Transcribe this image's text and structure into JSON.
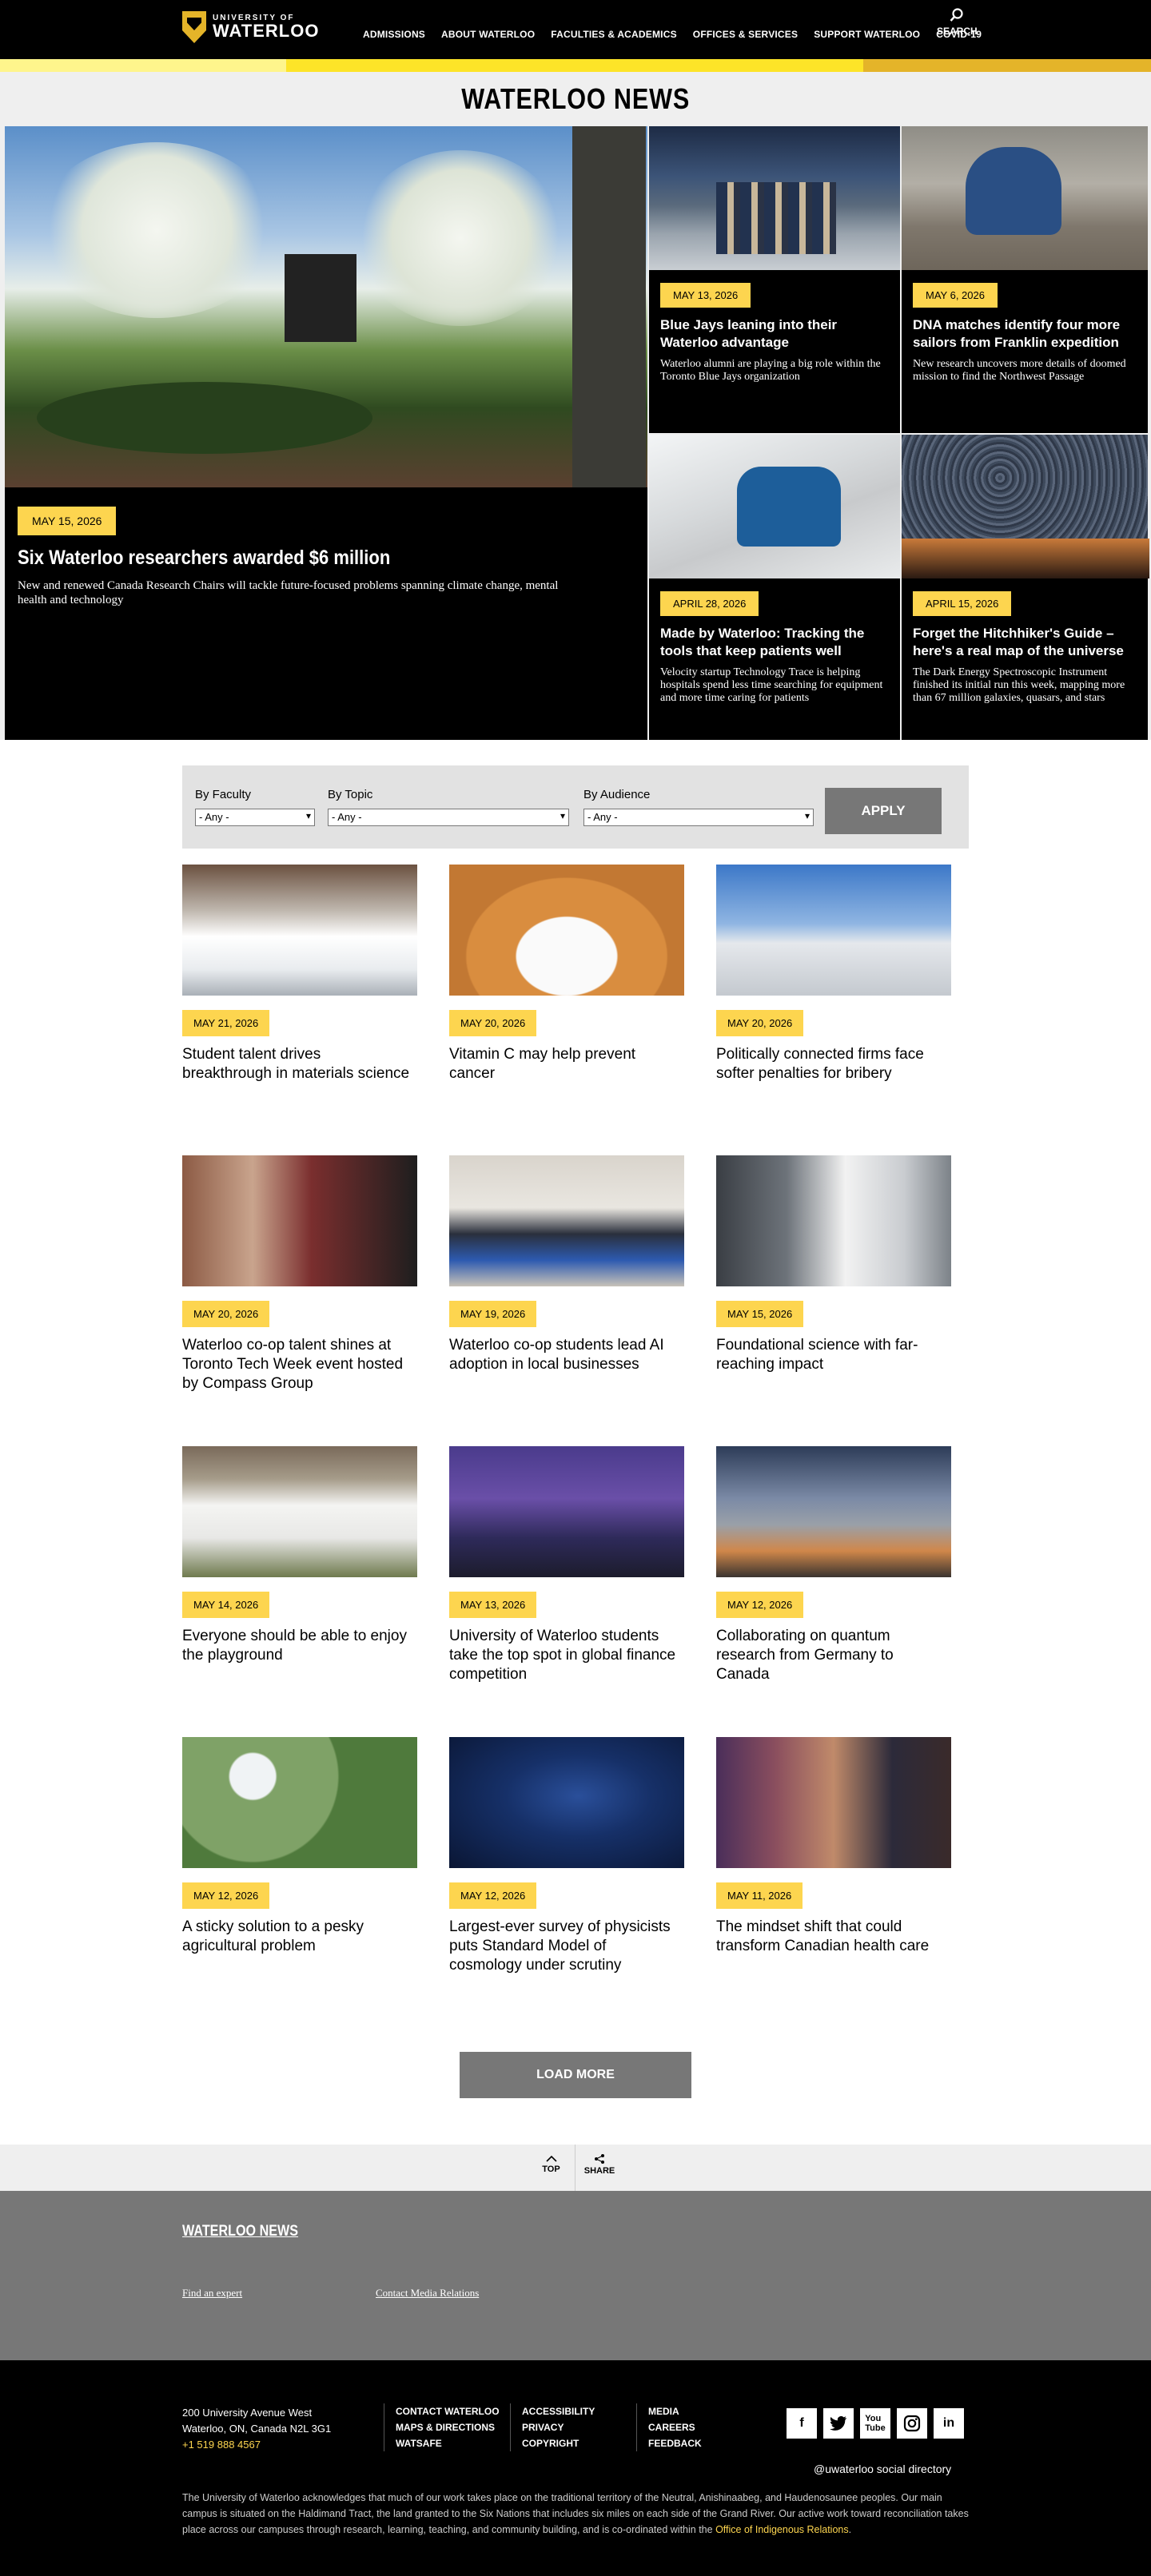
{
  "header": {
    "logo_small": "UNIVERSITY OF",
    "logo_big": "WATERLOO",
    "nav": [
      "ADMISSIONS",
      "ABOUT WATERLOO",
      "FACULTIES & ACADEMICS",
      "OFFICES & SERVICES",
      "SUPPORT WATERLOO",
      "COVID-19"
    ],
    "search_label": "SEARCH"
  },
  "colors": {
    "accent": "#fdd54f",
    "stripe": [
      "#fef58c",
      "#fde428",
      "#e4b429"
    ],
    "black": "#000000",
    "grey": "#777777"
  },
  "page_title": "WATERLOO NEWS",
  "hero": {
    "main": {
      "date": "MAY 15, 2026",
      "title": "Six Waterloo researchers awarded $6 million",
      "summary": "New and renewed Canada Research Chairs will tackle future-focused problems spanning climate change, mental health and technology"
    },
    "cards": [
      {
        "date": "MAY 13, 2026",
        "title": "Blue Jays leaning into their Waterloo advantage",
        "summary": "Waterloo alumni are playing a big role within the Toronto Blue Jays organization"
      },
      {
        "date": "MAY 6, 2026",
        "title": "DNA matches identify four more sailors from Franklin expedition",
        "summary": "New research uncovers more details of doomed mission to find the Northwest Passage"
      },
      {
        "date": "APRIL 28, 2026",
        "title": "Made by Waterloo: Tracking the tools that keep patients well",
        "summary": "Velocity startup Technology Trace is helping hospitals spend less time searching for equipment and more time caring for patients"
      },
      {
        "date": "APRIL 15, 2026",
        "title": "Forget the Hitchhiker's Guide – here's a real map of the universe",
        "summary": "The Dark Energy Spectroscopic Instrument finished its initial run this week, mapping more than 67 million galaxies, quasars, and stars"
      }
    ]
  },
  "filter": {
    "faculty_label": "By Faculty",
    "topic_label": "By Topic",
    "audience_label": "By Audience",
    "faculty_value": "- Any -",
    "topic_value": "- Any -",
    "audience_value": "- Any -",
    "apply_label": "APPLY"
  },
  "articles": [
    {
      "date": "MAY 21, 2026",
      "title": "Student talent drives breakthrough in materials science"
    },
    {
      "date": "MAY 20, 2026",
      "title": "Vitamin C may help prevent cancer"
    },
    {
      "date": "MAY 20, 2026",
      "title": "Politically connected firms face softer penalties for bribery"
    },
    {
      "date": "MAY 20, 2026",
      "title": "Waterloo co-op talent shines at Toronto Tech Week event hosted by Compass Group"
    },
    {
      "date": "MAY 19, 2026",
      "title": "Waterloo co-op students lead AI adoption in local businesses"
    },
    {
      "date": "MAY 15, 2026",
      "title": "Foundational science with far-reaching impact"
    },
    {
      "date": "MAY 14, 2026",
      "title": "Everyone should be able to enjoy the playground"
    },
    {
      "date": "MAY 13, 2026",
      "title": "University of Waterloo students take the top spot in global finance competition"
    },
    {
      "date": "MAY 12, 2026",
      "title": "Collaborating on quantum research from Germany to Canada"
    },
    {
      "date": "MAY 12, 2026",
      "title": "A sticky solution to a pesky agricultural problem"
    },
    {
      "date": "MAY 12, 2026",
      "title": "Largest-ever survey of physicists puts Standard Model of cosmology under scrutiny"
    },
    {
      "date": "MAY 11, 2026",
      "title": "The mindset shift that could transform Canadian health care"
    }
  ],
  "load_more_label": "LOAD MORE",
  "utility": {
    "top_label": "TOP",
    "share_label": "SHARE"
  },
  "grey_footer": {
    "title": "WATERLOO NEWS",
    "link1": "Find an expert",
    "link2": "Contact Media Relations"
  },
  "footer": {
    "address1": "200 University Avenue West",
    "address2": "Waterloo, ON, Canada  N2L 3G1",
    "phone": "+1 519 888 4567",
    "col1": [
      "CONTACT WATERLOO",
      "MAPS & DIRECTIONS",
      "WATSAFE"
    ],
    "col2": [
      "ACCESSIBILITY",
      "PRIVACY",
      "COPYRIGHT"
    ],
    "col3": [
      "MEDIA",
      "CAREERS",
      "FEEDBACK"
    ],
    "social_icons": [
      "facebook-icon",
      "twitter-icon",
      "youtube-icon",
      "instagram-icon",
      "linkedin-icon"
    ],
    "social_directory": "@uwaterloo social directory",
    "acknowledgement": "The University of Waterloo acknowledges that much of our work takes place on the traditional territory of the Neutral, Anishinaabeg, and Haudenosaunee peoples. Our main campus is situated on the Haldimand Tract, the land granted to the Six Nations that includes six miles on each side of the Grand River. Our active work toward reconciliation takes place across our campuses through research, learning, teaching, and community building, and is co-ordinated within the",
    "ack_link": "Office of Indigenous Relations",
    "ack_end": "."
  }
}
